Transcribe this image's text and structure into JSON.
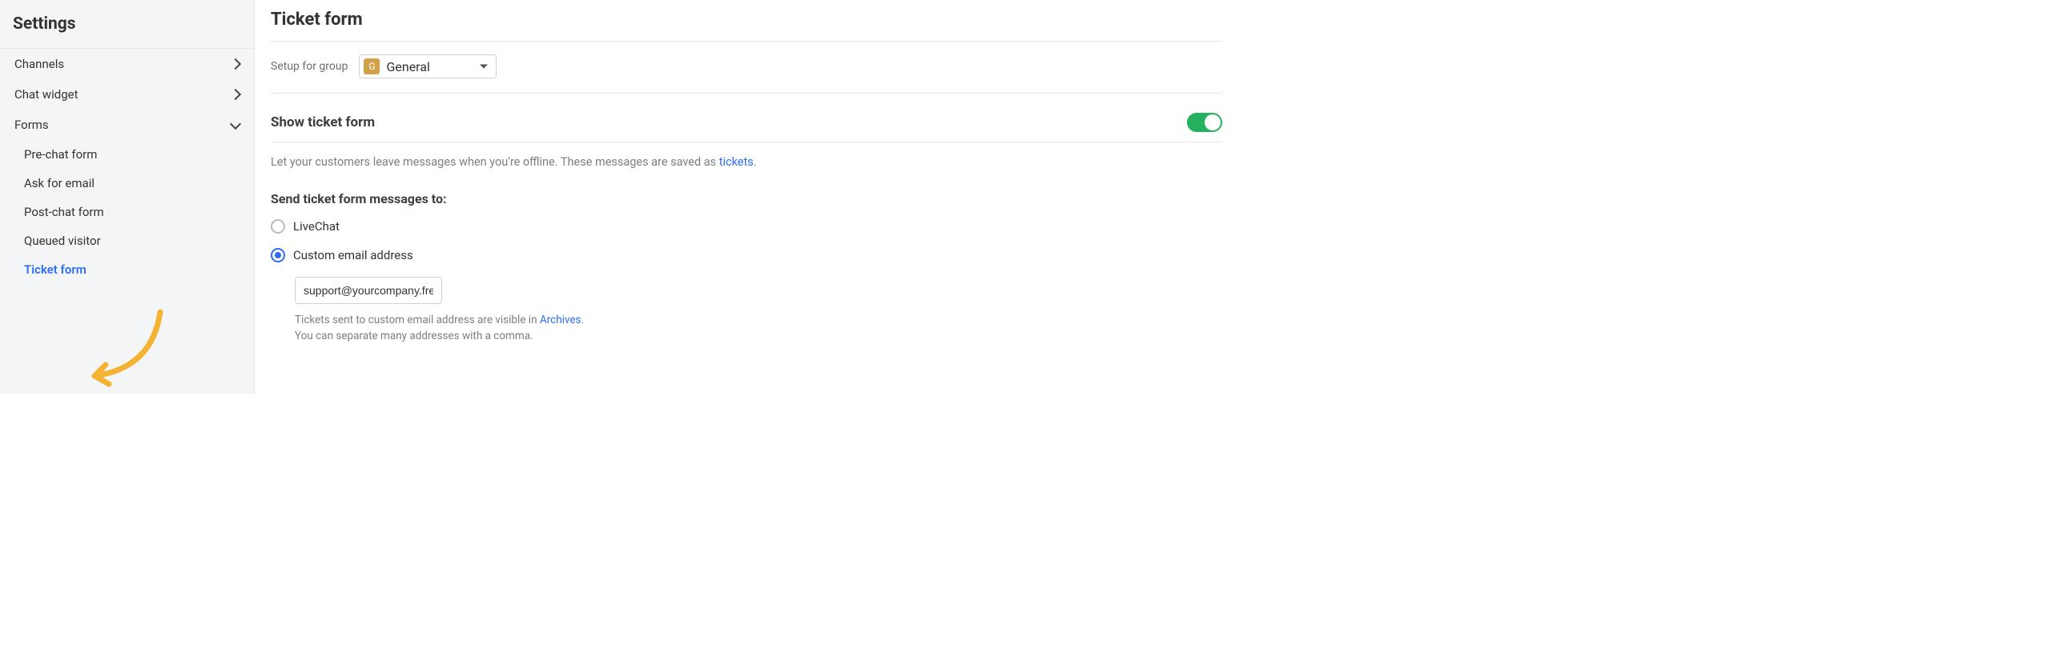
{
  "sidebar": {
    "title": "Settings",
    "items": [
      {
        "label": "Channels",
        "expanded": false
      },
      {
        "label": "Chat widget",
        "expanded": false
      },
      {
        "label": "Forms",
        "expanded": true
      }
    ],
    "formsSub": [
      {
        "label": "Pre-chat form"
      },
      {
        "label": "Ask for email"
      },
      {
        "label": "Post-chat form"
      },
      {
        "label": "Queued visitor"
      },
      {
        "label": "Ticket form",
        "active": true
      }
    ]
  },
  "main": {
    "title": "Ticket form",
    "groupLabel": "Setup for group",
    "groupBadge": "G",
    "groupValue": "General",
    "showSection": {
      "title": "Show ticket form",
      "enabled": true,
      "helpPrefix": "Let your customers leave messages when you're offline. These messages are saved as ",
      "helpLink": "tickets",
      "helpSuffix": "."
    },
    "sendSection": {
      "title": "Send ticket form messages to:",
      "options": [
        {
          "label": "LiveChat",
          "checked": false
        },
        {
          "label": "Custom email address",
          "checked": true
        }
      ],
      "emailValue": "support@yourcompany.freshdesk.com",
      "hintPrefix": "Tickets sent to custom email address are visible in ",
      "hintLink": "Archives",
      "hintSuffix": ".",
      "hintLine2": "You can separate many addresses with a comma."
    }
  }
}
